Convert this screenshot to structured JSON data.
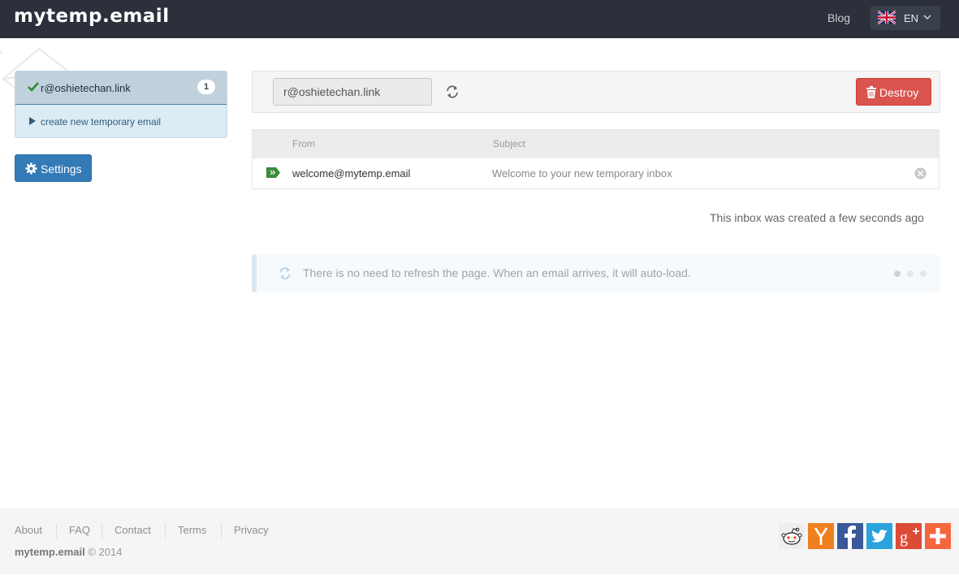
{
  "header": {
    "logo": "mytemp.email",
    "blog_label": "Blog",
    "language": "EN"
  },
  "sidebar": {
    "active_email": "r@oshietechan.link",
    "unread_count": "1",
    "create_label": "create new temporary email",
    "settings_label": "Settings"
  },
  "address_bar": {
    "value": "r@oshietechan.link",
    "destroy_label": "Destroy"
  },
  "inbox": {
    "columns": {
      "from": "From",
      "subject": "Subject"
    },
    "rows": [
      {
        "from": "welcome@mytemp.email",
        "subject": "Welcome to your new temporary inbox"
      }
    ],
    "created_text": "This inbox was created a few seconds ago"
  },
  "notice": {
    "text": "There is no need to refresh the page. When an email arrives, it will auto-load."
  },
  "footer": {
    "links": [
      "About",
      "FAQ",
      "Contact",
      "Terms",
      "Privacy"
    ],
    "copyright_brand": "mytemp.email",
    "copyright_text": "© 2014"
  },
  "social": {
    "items": [
      "reddit-icon",
      "hacker-news-icon",
      "facebook-icon",
      "twitter-icon",
      "google-plus-icon",
      "addthis-icon"
    ],
    "colors": [
      "#eeeeee",
      "#f0801f",
      "#3b5998",
      "#2aa3dd",
      "#dc4a38",
      "#f5663f"
    ]
  },
  "colors": {
    "navbar": "#2b303b",
    "primary": "#337ab7",
    "danger": "#d9534f",
    "success": "#3a8c3a"
  }
}
